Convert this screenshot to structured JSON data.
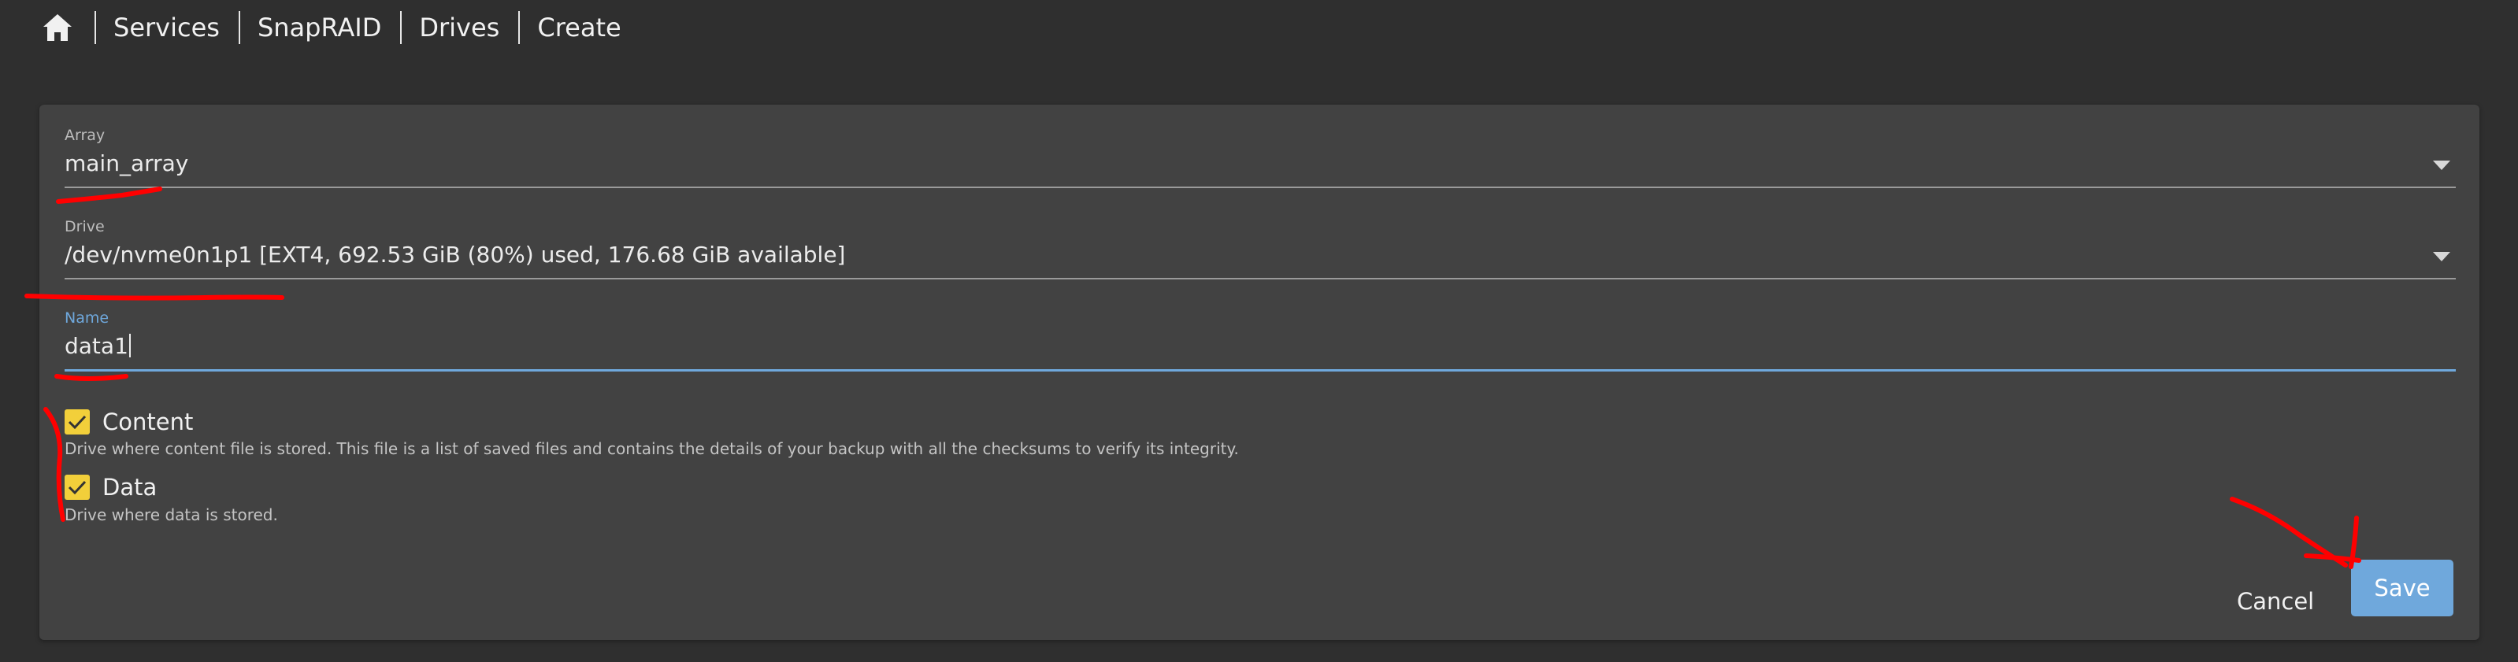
{
  "breadcrumb": {
    "home_icon": "home-icon",
    "items": [
      {
        "label": "Services"
      },
      {
        "label": "SnapRAID"
      },
      {
        "label": "Drives"
      },
      {
        "label": "Create"
      }
    ]
  },
  "form": {
    "array": {
      "label": "Array",
      "value": "main_array"
    },
    "drive": {
      "label": "Drive",
      "value": "/dev/nvme0n1p1 [EXT4, 692.53 GiB (80%) used, 176.68 GiB available]"
    },
    "name": {
      "label": "Name",
      "value": "data1"
    },
    "content": {
      "label": "Content",
      "checked": true,
      "hint": "Drive where content file is stored. This file is a list of saved files and contains the details of your backup with all the checksums to verify its integrity."
    },
    "data": {
      "label": "Data",
      "checked": true,
      "hint": "Drive where data is stored."
    }
  },
  "actions": {
    "cancel_label": "Cancel",
    "save_label": "Save"
  },
  "colors": {
    "background": "#2f2f2f",
    "card": "#424242",
    "accent": "#6fa8dc",
    "checkbox": "#f2cf3a",
    "annotation": "#ff0000"
  }
}
